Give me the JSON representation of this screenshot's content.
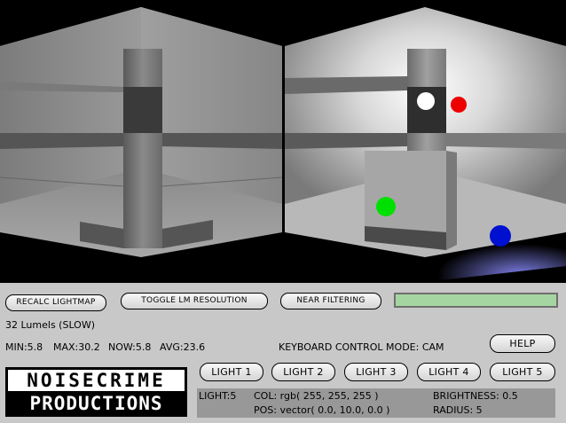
{
  "viewports": {
    "left": {
      "name": "unlit view"
    },
    "right": {
      "lights": [
        {
          "name": "light-white",
          "color": "#ffffff"
        },
        {
          "name": "light-red",
          "color": "#ff0000"
        },
        {
          "name": "light-green",
          "color": "#00e000"
        },
        {
          "name": "light-blue",
          "color": "#0010d0"
        }
      ]
    }
  },
  "toolbar": {
    "recalc_label": "RECALC LIGHTMAP",
    "toggle_label": "TOGGLE LM RESOLUTION",
    "filter_label": "NEAR FILTERING",
    "progress_fraction": 1.0,
    "progress_color": "#a5d6a1"
  },
  "lumels_text": "32 Lumels (SLOW)",
  "stats": {
    "min": "MIN:5.8",
    "max": "MAX:30.2",
    "now": "NOW:5.8",
    "avg": "AVG:23.6"
  },
  "keyboard_mode": "KEYBOARD CONTROL MODE: CAM",
  "help_label": "HELP",
  "light_buttons": [
    "LIGHT 1",
    "LIGHT 2",
    "LIGHT 3",
    "LIGHT 4",
    "LIGHT 5"
  ],
  "logo": {
    "line1": "NOISECRIME",
    "line2": "PRODUCTIONS"
  },
  "light_info": {
    "light": "LIGHT:5",
    "col": "COL: rgb( 255, 255, 255 )",
    "pos": "POS: vector( 0.0, 10.0, 0.0 )",
    "brightness": "BRIGHTNESS: 0.5",
    "radius": "RADIUS: 5"
  }
}
